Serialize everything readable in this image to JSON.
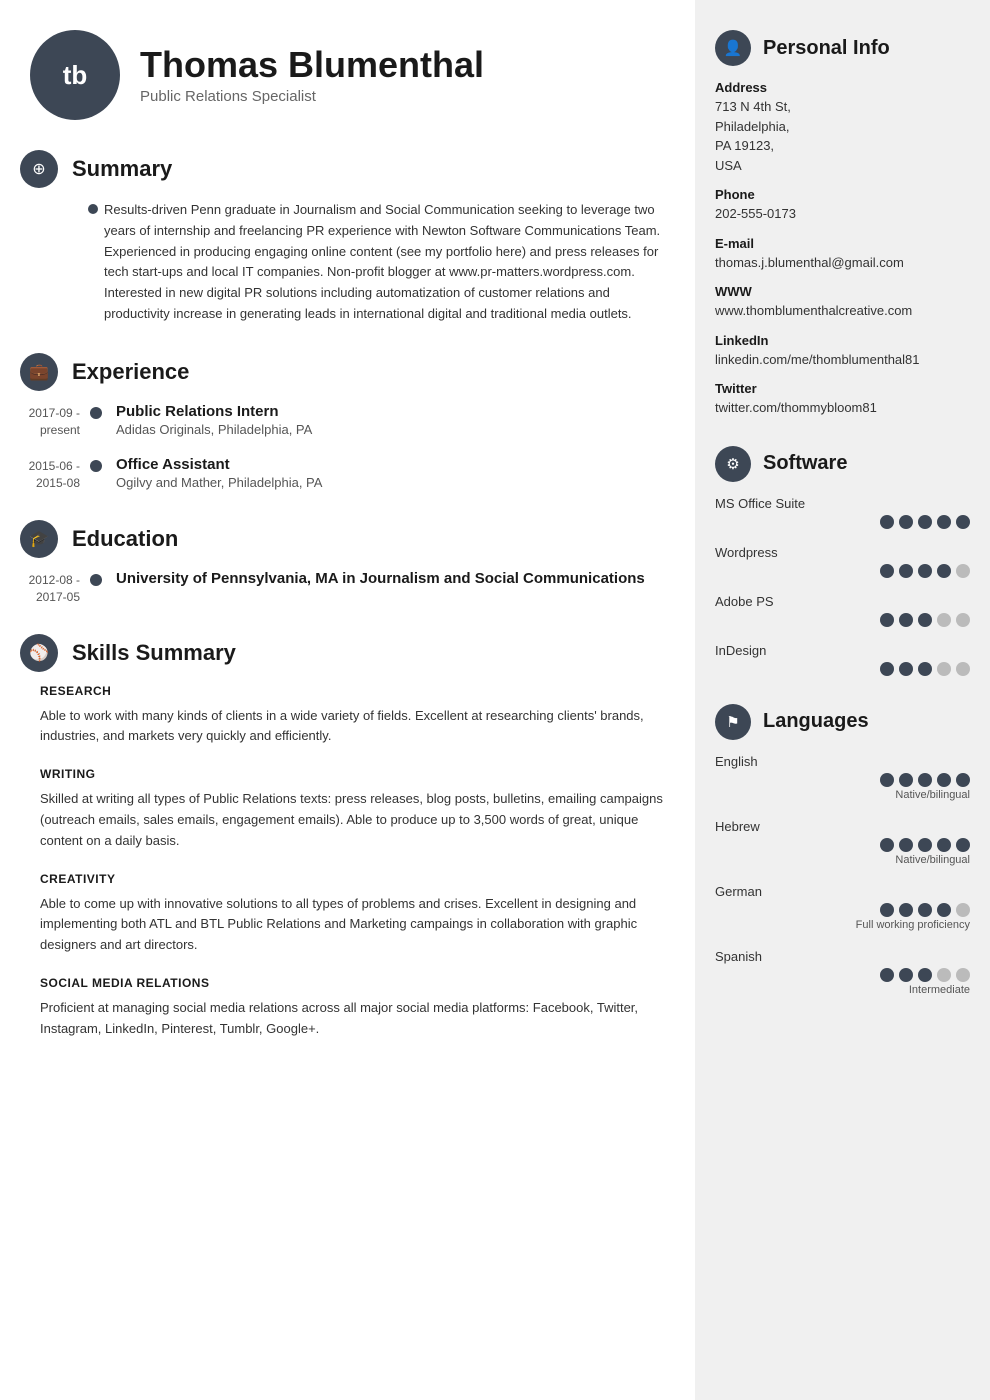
{
  "header": {
    "initials": "tb",
    "name": "Thomas Blumenthal",
    "subtitle": "Public Relations Specialist"
  },
  "sections": {
    "summary": {
      "title": "Summary",
      "icon": "target-icon",
      "text": "Results-driven Penn graduate in Journalism and Social Communication seeking to leverage two years of internship and freelancing PR experience with Newton Software Communications Team. Experienced in producing engaging online content (see my portfolio here) and press releases for tech start-ups and local IT companies. Non-profit blogger at www.pr-matters.wordpress.com. Interested in new digital PR solutions including automatization of customer relations and productivity increase in generating leads in international digital and traditional media outlets."
    },
    "experience": {
      "title": "Experience",
      "icon": "briefcase-icon",
      "items": [
        {
          "date": "2017-09 - present",
          "title": "Public Relations Intern",
          "subtitle": "Adidas Originals, Philadelphia, PA"
        },
        {
          "date": "2015-06 - 2015-08",
          "title": "Office Assistant",
          "subtitle": "Ogilvy and Mather, Philadelphia, PA"
        }
      ]
    },
    "education": {
      "title": "Education",
      "icon": "graduation-icon",
      "items": [
        {
          "date": "2012-08 - 2017-05",
          "title": "University of Pennsylvania, MA in Journalism and Social Communications",
          "subtitle": ""
        }
      ]
    },
    "skills": {
      "title": "Skills Summary",
      "icon": "skills-icon",
      "categories": [
        {
          "name": "RESEARCH",
          "desc": "Able to work with many kinds of clients in a wide variety of fields. Excellent at researching clients' brands, industries, and markets very quickly and efficiently."
        },
        {
          "name": "WRITING",
          "desc": "Skilled at writing all types of Public Relations texts: press releases, blog posts, bulletins, emailing campaigns (outreach emails, sales emails, engagement emails). Able to produce up to 3,500 words of great, unique content on a daily basis."
        },
        {
          "name": "CREATIVITY",
          "desc": "Able to come up with innovative solutions to all types of problems and crises. Excellent in designing and implementing both ATL and BTL Public Relations and Marketing campaings in collaboration with graphic designers and art directors."
        },
        {
          "name": "SOCIAL MEDIA RELATIONS",
          "desc": "Proficient at managing social media relations across all major social media platforms: Facebook, Twitter, Instagram, LinkedIn, Pinterest, Tumblr, Google+."
        }
      ]
    }
  },
  "sidebar": {
    "personal": {
      "title": "Personal Info",
      "icon": "person-icon",
      "fields": [
        {
          "label": "Address",
          "value": "713 N 4th St,\nPhiladelphia,\nPA 19123,\nUSA"
        },
        {
          "label": "Phone",
          "value": "202-555-0173"
        },
        {
          "label": "E-mail",
          "value": "thomas.j.blumenthal@gmail.com"
        },
        {
          "label": "WWW",
          "value": "www.thomblumenthalcreative.com"
        },
        {
          "label": "LinkedIn",
          "value": "linkedin.com/me/thomblumenthal81"
        },
        {
          "label": "Twitter",
          "value": "twitter.com/thommybloom81"
        }
      ]
    },
    "software": {
      "title": "Software",
      "icon": "software-icon",
      "items": [
        {
          "name": "MS Office Suite",
          "filled": 5,
          "total": 5
        },
        {
          "name": "Wordpress",
          "filled": 4,
          "total": 5
        },
        {
          "name": "Adobe PS",
          "filled": 3,
          "total": 5
        },
        {
          "name": "InDesign",
          "filled": 3,
          "total": 5
        }
      ]
    },
    "languages": {
      "title": "Languages",
      "icon": "flag-icon",
      "items": [
        {
          "name": "English",
          "filled": 5,
          "total": 5,
          "level": "Native/bilingual"
        },
        {
          "name": "Hebrew",
          "filled": 5,
          "total": 5,
          "level": "Native/bilingual"
        },
        {
          "name": "German",
          "filled": 4,
          "total": 5,
          "level": "Full working proficiency"
        },
        {
          "name": "Spanish",
          "filled": 3,
          "total": 5,
          "level": "Intermediate"
        }
      ]
    }
  }
}
